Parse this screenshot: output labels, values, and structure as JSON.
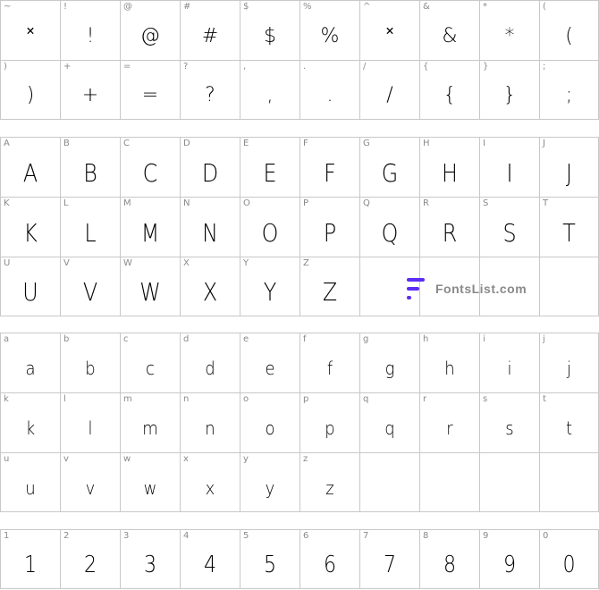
{
  "symbols": [
    {
      "key": "~",
      "glyph": "˟"
    },
    {
      "key": "!",
      "glyph": "!"
    },
    {
      "key": "@",
      "glyph": "@"
    },
    {
      "key": "#",
      "glyph": "#"
    },
    {
      "key": "$",
      "glyph": "$"
    },
    {
      "key": "%",
      "glyph": "%"
    },
    {
      "key": "^",
      "glyph": "˟"
    },
    {
      "key": "&",
      "glyph": "&"
    },
    {
      "key": "*",
      "glyph": "*"
    },
    {
      "key": "(",
      "glyph": "("
    },
    {
      "key": ")",
      "glyph": ")"
    },
    {
      "key": "+",
      "glyph": "+"
    },
    {
      "key": "=",
      "glyph": "="
    },
    {
      "key": "?",
      "glyph": "?"
    },
    {
      "key": ",",
      "glyph": ","
    },
    {
      "key": ".",
      "glyph": "."
    },
    {
      "key": "/",
      "glyph": "/"
    },
    {
      "key": "{",
      "glyph": "{"
    },
    {
      "key": "}",
      "glyph": "}"
    },
    {
      "key": ";",
      "glyph": ";"
    }
  ],
  "uppercase": [
    {
      "key": "A",
      "glyph": "A"
    },
    {
      "key": "B",
      "glyph": "B"
    },
    {
      "key": "C",
      "glyph": "C"
    },
    {
      "key": "D",
      "glyph": "D"
    },
    {
      "key": "E",
      "glyph": "E"
    },
    {
      "key": "F",
      "glyph": "F"
    },
    {
      "key": "G",
      "glyph": "G"
    },
    {
      "key": "H",
      "glyph": "H"
    },
    {
      "key": "I",
      "glyph": "I"
    },
    {
      "key": "J",
      "glyph": "J"
    },
    {
      "key": "K",
      "glyph": "K"
    },
    {
      "key": "L",
      "glyph": "L"
    },
    {
      "key": "M",
      "glyph": "M"
    },
    {
      "key": "N",
      "glyph": "N"
    },
    {
      "key": "O",
      "glyph": "O"
    },
    {
      "key": "P",
      "glyph": "P"
    },
    {
      "key": "Q",
      "glyph": "Q"
    },
    {
      "key": "R",
      "glyph": "R"
    },
    {
      "key": "S",
      "glyph": "S"
    },
    {
      "key": "T",
      "glyph": "T"
    },
    {
      "key": "U",
      "glyph": "U"
    },
    {
      "key": "V",
      "glyph": "V"
    },
    {
      "key": "W",
      "glyph": "W"
    },
    {
      "key": "X",
      "glyph": "X"
    },
    {
      "key": "Y",
      "glyph": "Y"
    },
    {
      "key": "Z",
      "glyph": "Z"
    }
  ],
  "lowercase": [
    {
      "key": "a",
      "glyph": "a"
    },
    {
      "key": "b",
      "glyph": "b"
    },
    {
      "key": "c",
      "glyph": "c"
    },
    {
      "key": "d",
      "glyph": "d"
    },
    {
      "key": "e",
      "glyph": "e"
    },
    {
      "key": "f",
      "glyph": "f"
    },
    {
      "key": "g",
      "glyph": "g"
    },
    {
      "key": "h",
      "glyph": "h"
    },
    {
      "key": "i",
      "glyph": "i"
    },
    {
      "key": "j",
      "glyph": "j"
    },
    {
      "key": "k",
      "glyph": "k"
    },
    {
      "key": "l",
      "glyph": "l"
    },
    {
      "key": "m",
      "glyph": "m"
    },
    {
      "key": "n",
      "glyph": "n"
    },
    {
      "key": "o",
      "glyph": "o"
    },
    {
      "key": "p",
      "glyph": "p"
    },
    {
      "key": "q",
      "glyph": "q"
    },
    {
      "key": "r",
      "glyph": "r"
    },
    {
      "key": "s",
      "glyph": "s"
    },
    {
      "key": "t",
      "glyph": "t"
    },
    {
      "key": "u",
      "glyph": "u"
    },
    {
      "key": "v",
      "glyph": "v"
    },
    {
      "key": "w",
      "glyph": "w"
    },
    {
      "key": "x",
      "glyph": "x"
    },
    {
      "key": "y",
      "glyph": "y"
    },
    {
      "key": "z",
      "glyph": "z"
    }
  ],
  "digits": [
    {
      "key": "1",
      "glyph": "1"
    },
    {
      "key": "2",
      "glyph": "2"
    },
    {
      "key": "3",
      "glyph": "3"
    },
    {
      "key": "4",
      "glyph": "4"
    },
    {
      "key": "5",
      "glyph": "5"
    },
    {
      "key": "6",
      "glyph": "6"
    },
    {
      "key": "7",
      "glyph": "7"
    },
    {
      "key": "8",
      "glyph": "8"
    },
    {
      "key": "9",
      "glyph": "9"
    },
    {
      "key": "0",
      "glyph": "0"
    }
  ],
  "watermark": {
    "text": "FontsList.com",
    "accent": "#5b2df5",
    "icon": "fontslist-logo-icon"
  }
}
